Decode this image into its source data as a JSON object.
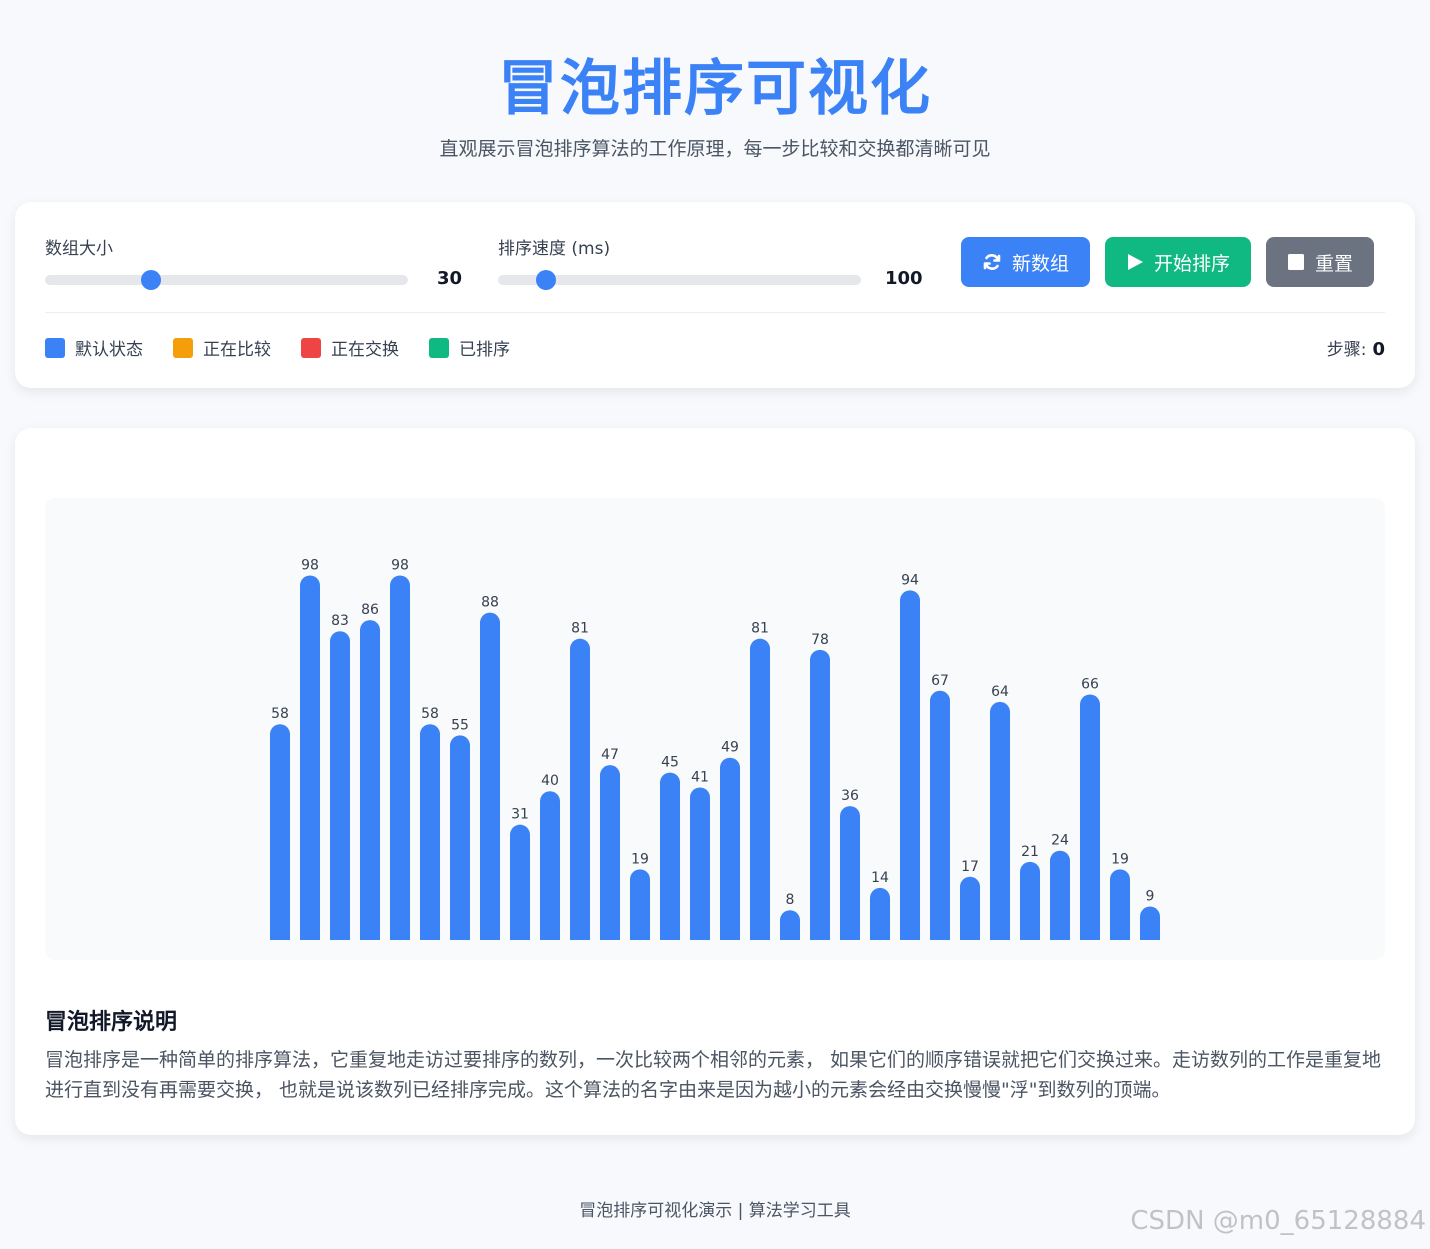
{
  "header": {
    "title": "冒泡排序可视化",
    "subtitle": "直观展示冒泡排序算法的工作原理，每一步比较和交换都清晰可见"
  },
  "controls": {
    "size_label": "数组大小",
    "size_value": "30",
    "size_fraction": 0.28,
    "speed_label": "排序速度 (ms)",
    "speed_value": "100",
    "speed_fraction": 0.11,
    "new_array_label": "新数组",
    "start_label": "开始排序",
    "reset_label": "重置"
  },
  "legend": {
    "default": "默认状态",
    "comparing": "正在比较",
    "swapping": "正在交换",
    "sorted": "已排序"
  },
  "status": {
    "steps_label": "步骤:",
    "steps_value": "0"
  },
  "colors": {
    "default": "#3b82f6",
    "comparing": "#f59e0b",
    "swapping": "#ef4444",
    "sorted": "#10b981"
  },
  "chart_data": {
    "type": "bar",
    "values": [
      58,
      98,
      83,
      86,
      98,
      58,
      55,
      88,
      31,
      40,
      81,
      47,
      19,
      45,
      41,
      49,
      81,
      8,
      78,
      36,
      14,
      94,
      67,
      17,
      64,
      21,
      24,
      66,
      19,
      9
    ],
    "ylim": [
      0,
      100
    ],
    "grid": false,
    "legend": "none"
  },
  "description": {
    "title": "冒泡排序说明",
    "text": "冒泡排序是一种简单的排序算法，它重复地走访过要排序的数列，一次比较两个相邻的元素， 如果它们的顺序错误就把它们交换过来。走访数列的工作是重复地进行直到没有再需要交换， 也就是说该数列已经排序完成。这个算法的名字由来是因为越小的元素会经由交换慢慢\"浮\"到数列的顶端。"
  },
  "footer": {
    "text": "冒泡排序可视化演示 | 算法学习工具"
  },
  "watermark": "CSDN @m0_65128884"
}
